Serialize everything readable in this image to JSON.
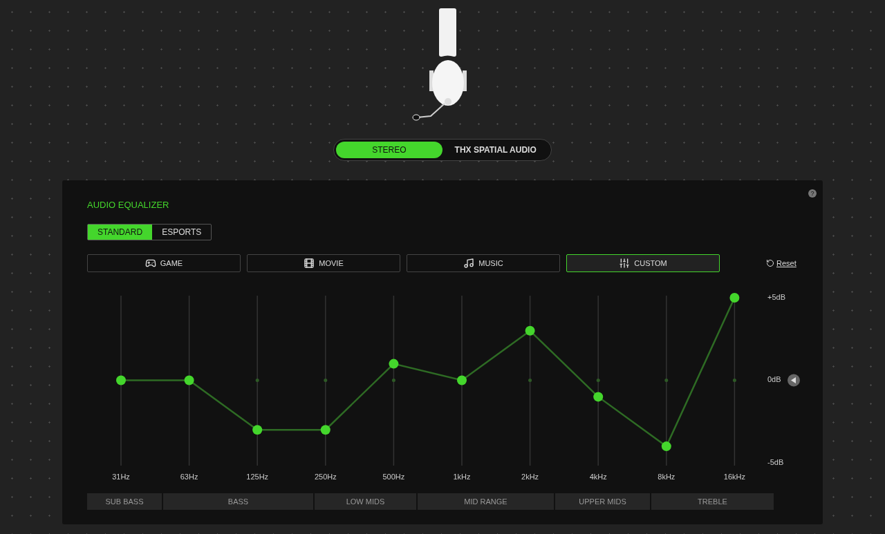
{
  "mode_toggle": [
    {
      "label": "STEREO",
      "selected": true
    },
    {
      "label": "THX SPATIAL AUDIO",
      "selected": false
    }
  ],
  "equalizer": {
    "title": "AUDIO EQUALIZER",
    "tabs": [
      {
        "label": "STANDARD",
        "selected": true
      },
      {
        "label": "ESPORTS",
        "selected": false
      }
    ],
    "presets": [
      {
        "label": "GAME",
        "kind": "game",
        "selected": false
      },
      {
        "label": "MOVIE",
        "kind": "movie",
        "selected": false
      },
      {
        "label": "MUSIC",
        "kind": "music",
        "selected": false
      },
      {
        "label": "CUSTOM",
        "kind": "custom",
        "selected": true
      }
    ],
    "help": "?",
    "reset": "Reset",
    "chart_data": {
      "type": "line",
      "categories": [
        "31Hz",
        "63Hz",
        "125Hz",
        "250Hz",
        "500Hz",
        "1kHz",
        "2kHz",
        "4kHz",
        "8kHz",
        "16kHz"
      ],
      "series": [
        {
          "color": "#2e6b24",
          "marker": "circle",
          "values": [
            0,
            0,
            -3,
            -3,
            1,
            0,
            3,
            -1,
            -4,
            5
          ]
        }
      ],
      "grid": true,
      "ylim": [
        -5,
        5
      ],
      "yticks": [
        {
          "value": 5,
          "label": "+5dB"
        },
        {
          "value": 0,
          "label": "0dB"
        },
        {
          "value": -5,
          "label": "-5dB"
        }
      ]
    },
    "bands": [
      "SUB BASS",
      "BASS",
      "LOW MIDS",
      "MID RANGE",
      "UPPER MIDS",
      "TREBLE"
    ]
  }
}
